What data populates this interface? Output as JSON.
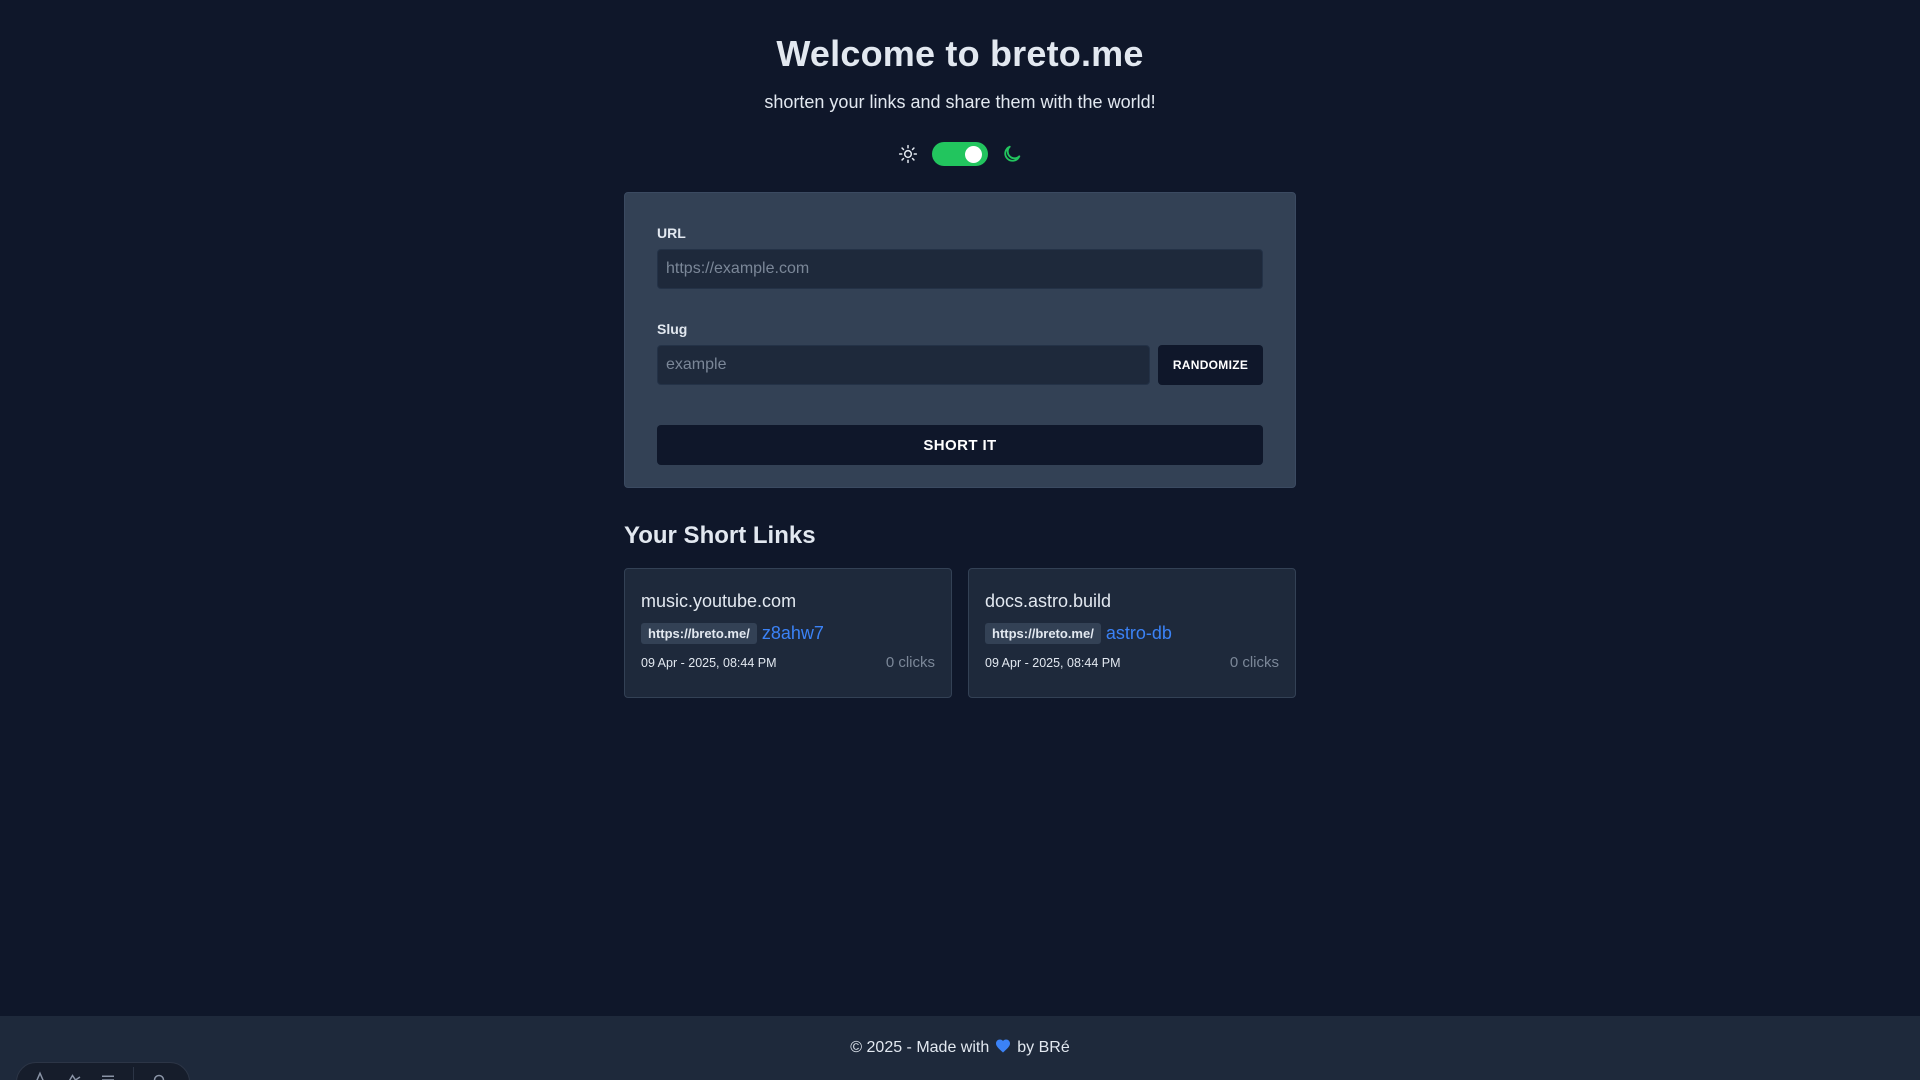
{
  "hero": {
    "title": "Welcome to breto.me",
    "subtitle": "shorten your links and share them with the world!"
  },
  "theme": {
    "light_icon": "sun-icon",
    "dark_icon": "moon-icon",
    "dark_mode_enabled": true,
    "toggle_color": "#22c55e"
  },
  "form": {
    "url_label": "URL",
    "url_placeholder": "https://example.com",
    "url_value": "",
    "slug_label": "Slug",
    "slug_placeholder": "example",
    "slug_value": "",
    "randomize_label": "RANDOMIZE",
    "submit_label": "SHORT IT"
  },
  "links": {
    "title": "Your Short Links",
    "items": [
      {
        "host": "music.youtube.com",
        "prefix": "https://breto.me/",
        "slug": "z8ahw7",
        "date": "09 Apr - 2025, 08:44 PM",
        "clicks": "0 clicks"
      },
      {
        "host": "docs.astro.build",
        "prefix": "https://breto.me/",
        "slug": "astro-db",
        "date": "09 Apr - 2025, 08:44 PM",
        "clicks": "0 clicks"
      }
    ]
  },
  "footer": {
    "prefix": "© 2025 - Made with",
    "heart_icon": "heart-icon",
    "suffix": "by BRé"
  },
  "colors": {
    "background": "#0f172a",
    "card": "#334155",
    "accent": "#3b82f6",
    "toggle": "#22c55e"
  }
}
